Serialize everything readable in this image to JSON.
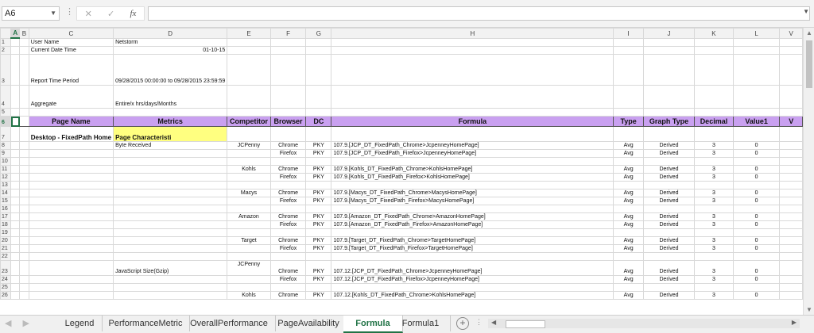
{
  "formula_bar": {
    "name_box": "A6",
    "formula": ""
  },
  "columns": [
    "A",
    "B",
    "C",
    "D",
    "E",
    "F",
    "G",
    "H",
    "I",
    "J",
    "K",
    "L",
    "V"
  ],
  "header_row": [
    "Page Name",
    "Metrics",
    "Competitor",
    "Browser",
    "DC",
    "Formula",
    "Type",
    "Graph Type",
    "Decimal",
    "Value1",
    "V"
  ],
  "info": {
    "user_label": "User Name",
    "user_value": "Netstorm",
    "date_label": "Current Date Time",
    "date_value": "01-10-15",
    "period_label": "Report Time Period",
    "period_value": "09/28/2015 00:00:00 to 09/28/2015 23:59:59",
    "aggregate_label": "Aggregate",
    "aggregate_value": "Entire/x hrs/days/Months"
  },
  "rows": [
    {
      "num": "7",
      "c": "Desktop - FixedPath Home",
      "d": "Page Characteristi"
    },
    {
      "num": "8",
      "d": "Byte Received",
      "e": "JCPenny",
      "f": "Chrome",
      "g": "PKY",
      "h": "107.9.[JCP_DT_FixedPath_Chrome>JcpenneyHomePage]",
      "i": "Avg",
      "j": "Derived",
      "k": "3",
      "l": "0"
    },
    {
      "num": "9",
      "f": "Firefox",
      "g": "PKY",
      "h": "107.9.[JCP_DT_FixedPath_Firefox>JcpenneyHomePage]",
      "i": "Avg",
      "j": "Derived",
      "k": "3",
      "l": "0"
    },
    {
      "num": "10"
    },
    {
      "num": "11",
      "e": "Kohls",
      "f": "Chrome",
      "g": "PKY",
      "h": "107.9.[Kohls_DT_FixedPath_Chrome>KohlsHomePage]",
      "i": "Avg",
      "j": "Derived",
      "k": "3",
      "l": "0"
    },
    {
      "num": "12",
      "f": "Firefox",
      "g": "PKY",
      "h": "107.9.[Kohls_DT_FixedPath_Firefox>KohlsHomePage]",
      "i": "Avg",
      "j": "Derived",
      "k": "3",
      "l": "0"
    },
    {
      "num": "13"
    },
    {
      "num": "14",
      "e": "Macys",
      "f": "Chrome",
      "g": "PKY",
      "h": "107.9.[Macys_DT_FixedPath_Chrome>MacysHomePage]",
      "i": "Avg",
      "j": "Derived",
      "k": "3",
      "l": "0"
    },
    {
      "num": "15",
      "f": "Firefox",
      "g": "PKY",
      "h": "107.9.[Macys_DT_FixedPath_Firefox>MacysHomePage]",
      "i": "Avg",
      "j": "Derived",
      "k": "3",
      "l": "0"
    },
    {
      "num": "16"
    },
    {
      "num": "17",
      "e": "Amazon",
      "f": "Chrome",
      "g": "PKY",
      "h": "107.9.[Amazon_DT_FixedPath_Chrome>AmazonHomePage]",
      "i": "Avg",
      "j": "Derived",
      "k": "3",
      "l": "0"
    },
    {
      "num": "18",
      "f": "Firefox",
      "g": "PKY",
      "h": "107.9.[Amazon_DT_FixedPath_Firefox>AmazonHomePage]",
      "i": "Avg",
      "j": "Derived",
      "k": "3",
      "l": "0"
    },
    {
      "num": "19"
    },
    {
      "num": "20",
      "e": "Target",
      "f": "Chrome",
      "g": "PKY",
      "h": "107.9.[Target_DT_FixedPath_Chrome>TargetHomePage]",
      "i": "Avg",
      "j": "Derived",
      "k": "3",
      "l": "0"
    },
    {
      "num": "21",
      "f": "Firefox",
      "g": "PKY",
      "h": "107.9.[Target_DT_FixedPath_Firefox>TargetHomePage]",
      "i": "Avg",
      "j": "Derived",
      "k": "3",
      "l": "0"
    },
    {
      "num": "22"
    },
    {
      "num": "23",
      "d": "JavaScript Size(Gzip)",
      "e": "JCPenny",
      "f": "Chrome",
      "g": "PKY",
      "h": "107.12.[JCP_DT_FixedPath_Chrome>JcpenneyHomePage]",
      "i": "Avg",
      "j": "Derived",
      "k": "3",
      "l": "0"
    },
    {
      "num": "24",
      "f": "Firefox",
      "g": "PKY",
      "h": "107.12.[JCP_DT_FixedPath_Firefox>JcpenneyHomePage]",
      "i": "Avg",
      "j": "Derived",
      "k": "3",
      "l": "0"
    },
    {
      "num": "25"
    },
    {
      "num": "26",
      "e": "Kohls",
      "f": "Chrome",
      "g": "PKY",
      "h": "107.12.[Kohls_DT_FixedPath_Chrome>KohlsHomePage]",
      "i": "Avg",
      "j": "Derived",
      "k": "3",
      "l": "0"
    }
  ],
  "sheet_tabs": [
    "Legend",
    "PerformanceMetric",
    "OverallPerformance",
    "PageAvailability",
    "Formula",
    "Formula1"
  ],
  "active_tab": "Formula",
  "colors": {
    "header_fill": "#c9a0f0",
    "highlight_fill": "#ffff80",
    "accent": "#217346"
  }
}
